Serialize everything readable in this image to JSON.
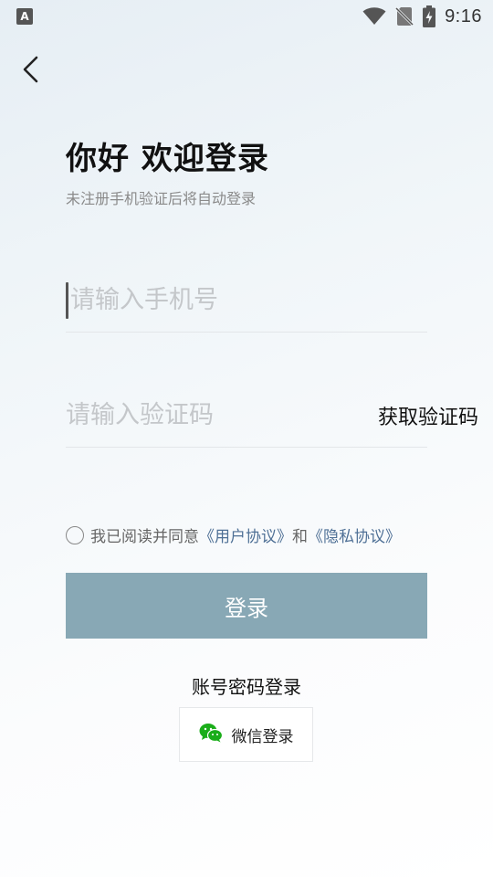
{
  "status_bar": {
    "app_badge": "A",
    "time": "9:16",
    "icons": [
      "wifi-icon",
      "no-sim-icon",
      "battery-charging-icon"
    ]
  },
  "header": {
    "back_icon": "chevron-left-icon"
  },
  "login": {
    "title": "你好 欢迎登录",
    "subtitle": "未注册手机验证后将自动登录",
    "phone_placeholder": "请输入手机号",
    "phone_value": "",
    "code_placeholder": "请输入验证码",
    "code_value": "",
    "get_code_label": "获取验证码",
    "agreement": {
      "prefix": "我已阅读并同意",
      "user_agreement": "《用户协议》",
      "conjunction": "和",
      "privacy_policy": "《隐私协议》"
    },
    "login_button_label": "登录",
    "password_login_label": "账号密码登录",
    "wechat_login_label": "微信登录"
  },
  "colors": {
    "login_button": "#88a8b5",
    "link": "#4f7096",
    "wechat_green": "#1aad19"
  }
}
